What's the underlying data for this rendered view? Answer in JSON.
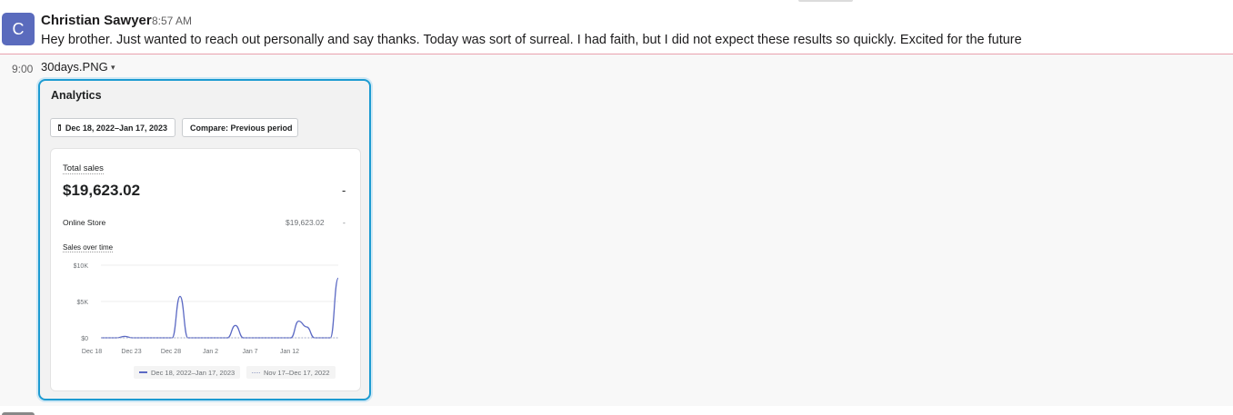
{
  "message": {
    "avatar_letter": "C",
    "author": "Christian Sawyer",
    "time": "8:57 AM",
    "text": "Hey brother. Just wanted to reach out personally and say thanks. Today was sort of surreal. I had faith, but I did not expect these results so quickly. Excited for the future"
  },
  "followup": {
    "time": "9:00",
    "file_name": "30days.PNG",
    "file_caret": "▾"
  },
  "analytics": {
    "title": "Analytics",
    "date_range_button": "Dec 18, 2022–Jan 17, 2023",
    "compare_button": "Compare: Previous period",
    "total_sales_label": "Total sales",
    "total_sales_value": "$19,623.02",
    "total_sales_change": "-",
    "online_store_label": "Online Store",
    "online_store_value": "$19,623.02",
    "online_store_change": "-",
    "chart_title": "Sales over time",
    "legend_current": "Dec 18, 2022–Jan 17, 2023",
    "legend_previous": "Nov 17–Dec 17, 2022"
  },
  "chart_data": {
    "type": "line",
    "title": "Sales over time",
    "x_ticks": [
      "Dec 18",
      "Dec 23",
      "Dec 28",
      "Jan 2",
      "Jan 7",
      "Jan 12"
    ],
    "y_ticks": [
      "$0",
      "$5K",
      "$10K"
    ],
    "ylim": [
      0,
      10000
    ],
    "x": [
      "Dec 18",
      "Dec 19",
      "Dec 20",
      "Dec 21",
      "Dec 22",
      "Dec 23",
      "Dec 24",
      "Dec 25",
      "Dec 26",
      "Dec 27",
      "Dec 28",
      "Dec 29",
      "Dec 30",
      "Dec 31",
      "Jan 1",
      "Jan 2",
      "Jan 3",
      "Jan 4",
      "Jan 5",
      "Jan 6",
      "Jan 7",
      "Jan 8",
      "Jan 9",
      "Jan 10",
      "Jan 11",
      "Jan 12",
      "Jan 13",
      "Jan 14",
      "Jan 15",
      "Jan 16",
      "Jan 17"
    ],
    "series": [
      {
        "name": "Dec 18, 2022–Jan 17, 2023",
        "values": [
          0,
          0,
          0,
          200,
          0,
          0,
          0,
          0,
          0,
          0,
          5700,
          0,
          0,
          0,
          0,
          0,
          0,
          1700,
          0,
          0,
          0,
          0,
          0,
          0,
          0,
          2300,
          1500,
          0,
          0,
          0,
          8200
        ],
        "color": "#5c6ac4"
      },
      {
        "name": "Nov 17–Dec 17, 2022",
        "values": [
          0,
          0,
          0,
          0,
          0,
          0,
          0,
          0,
          0,
          0,
          0,
          0,
          0,
          0,
          0,
          0,
          0,
          0,
          0,
          0,
          0,
          0,
          0,
          0,
          0,
          0,
          0,
          0,
          0,
          0,
          0
        ],
        "color": "#9aa3c8"
      }
    ],
    "grid": true,
    "legend_position": "bottom"
  }
}
